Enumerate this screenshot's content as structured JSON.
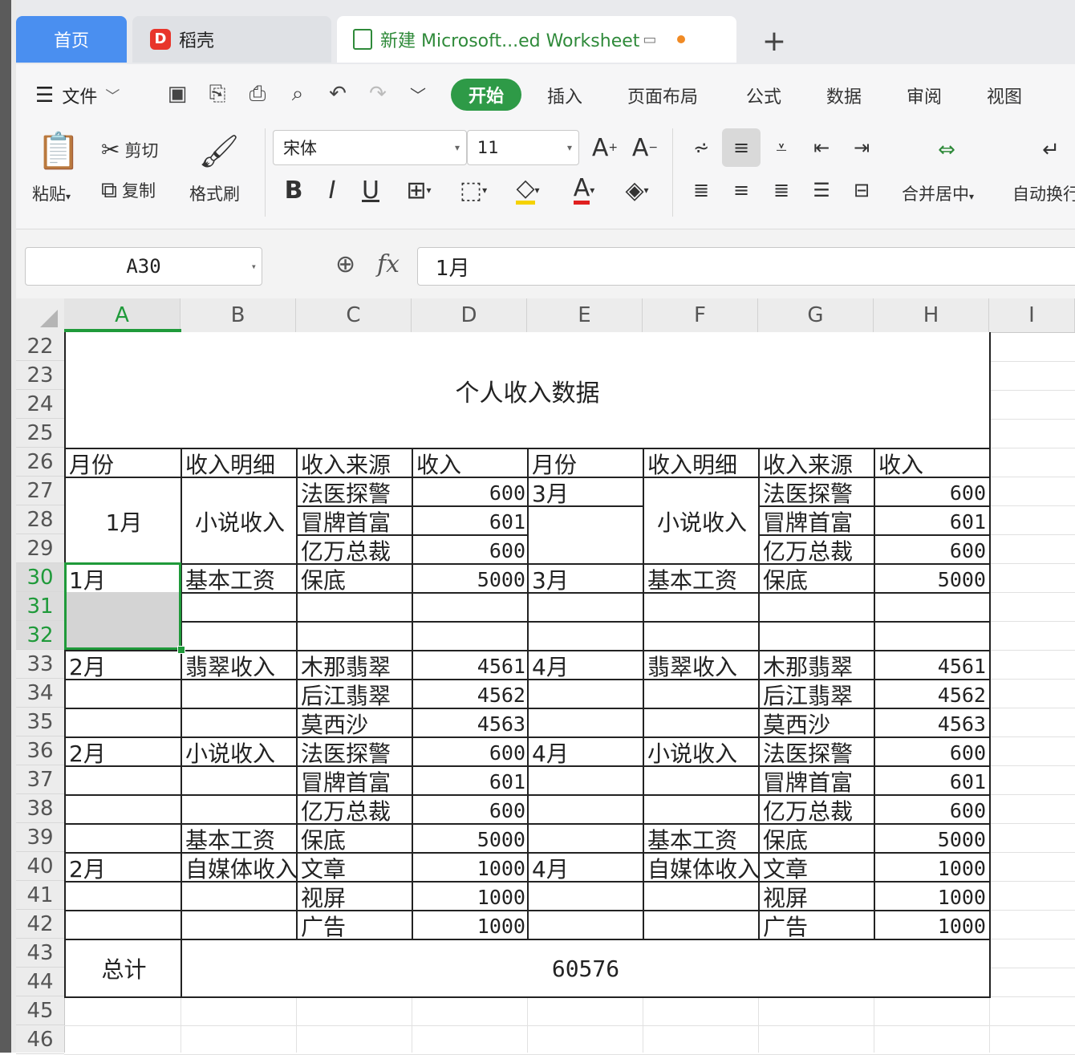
{
  "tabs": {
    "home": "首页",
    "daoke": "稻壳",
    "sheet": "新建 Microsoft...ed Worksheet",
    "add": "+"
  },
  "menu": {
    "file": "文件",
    "start": "开始",
    "items": [
      "插入",
      "页面布局",
      "公式",
      "数据",
      "审阅",
      "视图"
    ]
  },
  "ribbon": {
    "paste": "粘贴",
    "cut": "剪切",
    "copy": "复制",
    "format_painter": "格式刷",
    "font_name": "宋体",
    "font_size": "11",
    "merge_center": "合并居中",
    "wrap": "自动换行"
  },
  "formula_bar": {
    "name_box": "A30",
    "fx": "fx",
    "value": "1月"
  },
  "columns": [
    "A",
    "B",
    "C",
    "D",
    "E",
    "F",
    "G",
    "H",
    "I"
  ],
  "rows": [
    "22",
    "23",
    "24",
    "25",
    "26",
    "27",
    "28",
    "29",
    "30",
    "31",
    "32",
    "33",
    "34",
    "35",
    "36",
    "37",
    "38",
    "39",
    "40",
    "41",
    "42",
    "43",
    "44",
    "45",
    "46"
  ],
  "sheet": {
    "title": "个人收入数据",
    "headers": [
      "月份",
      "收入明细",
      "收入来源",
      "收入",
      "月份",
      "收入明细",
      "收入来源",
      "收入"
    ],
    "left": {
      "m1": "1月",
      "c_novel": "小说收入",
      "r27": {
        "src": "法医探警",
        "val": "600"
      },
      "r28": {
        "src": "冒牌首富",
        "val": "601"
      },
      "r29": {
        "src": "亿万总裁",
        "val": "600"
      },
      "r30": {
        "month": "1月",
        "detail": "基本工资",
        "src": "保底",
        "val": "5000"
      },
      "r33": {
        "month": "2月",
        "detail": "翡翠收入",
        "src": "木那翡翠",
        "val": "4561"
      },
      "r34": {
        "src": "后江翡翠",
        "val": "4562"
      },
      "r35": {
        "src": "莫西沙",
        "val": "4563"
      },
      "r36": {
        "month": "2月",
        "detail": "小说收入",
        "src": "法医探警",
        "val": "600"
      },
      "r37": {
        "src": "冒牌首富",
        "val": "601"
      },
      "r38": {
        "src": "亿万总裁",
        "val": "600"
      },
      "r39": {
        "detail": "基本工资",
        "src": "保底",
        "val": "5000"
      },
      "r40": {
        "month": "2月",
        "detail": "自媒体收入",
        "src": "文章",
        "val": "1000"
      },
      "r41": {
        "src": "视屏",
        "val": "1000"
      },
      "r42": {
        "src": "广告",
        "val": "1000"
      }
    },
    "right": {
      "r27": {
        "month": "3月",
        "src": "法医探警",
        "val": "600"
      },
      "c_novel": "小说收入",
      "r28": {
        "src": "冒牌首富",
        "val": "601"
      },
      "r29": {
        "src": "亿万总裁",
        "val": "600"
      },
      "r30": {
        "month": "3月",
        "detail": "基本工资",
        "src": "保底",
        "val": "5000"
      },
      "r33": {
        "month": "4月",
        "detail": "翡翠收入",
        "src": "木那翡翠",
        "val": "4561"
      },
      "r34": {
        "src": "后江翡翠",
        "val": "4562"
      },
      "r35": {
        "src": "莫西沙",
        "val": "4563"
      },
      "r36": {
        "month": "4月",
        "detail": "小说收入",
        "src": "法医探警",
        "val": "600"
      },
      "r37": {
        "src": "冒牌首富",
        "val": "601"
      },
      "r38": {
        "src": "亿万总裁",
        "val": "600"
      },
      "r39": {
        "detail": "基本工资",
        "src": "保底",
        "val": "5000"
      },
      "r40": {
        "month": "4月",
        "detail": "自媒体收入",
        "src": "文章",
        "val": "1000"
      },
      "r41": {
        "src": "视屏",
        "val": "1000"
      },
      "r42": {
        "src": "广告",
        "val": "1000"
      }
    },
    "total_label": "总计",
    "total_value": "60576"
  },
  "colors": {
    "accent_green": "#2e9a47",
    "home_tab": "#4a8ff0",
    "selection": "#1f9a3a"
  }
}
